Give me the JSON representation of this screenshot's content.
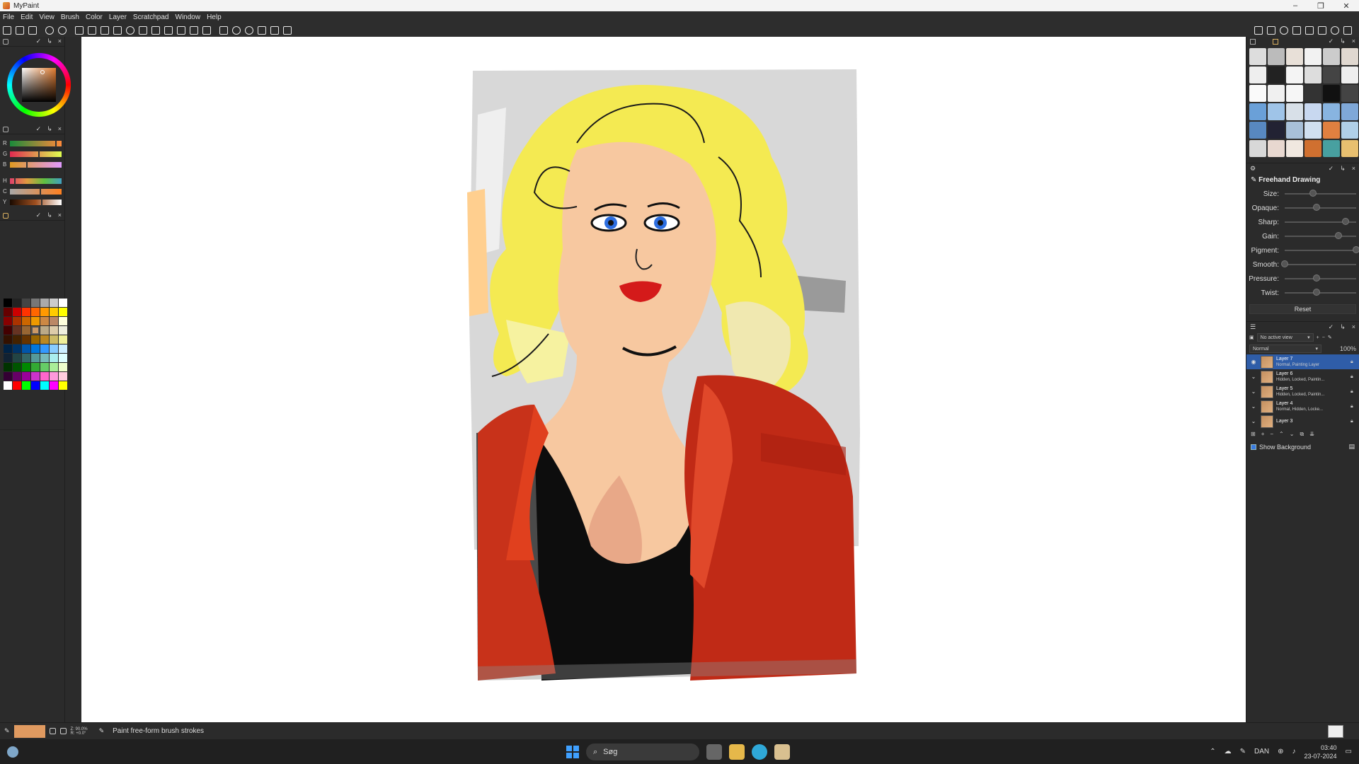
{
  "window": {
    "title": "MyPaint",
    "controls": [
      "–",
      "❐",
      "✕"
    ]
  },
  "menu": [
    "File",
    "Edit",
    "View",
    "Brush",
    "Color",
    "Layer",
    "Scratchpad",
    "Window",
    "Help"
  ],
  "color_sliders": {
    "labels": [
      "R",
      "G",
      "B",
      "H",
      "C",
      "Y"
    ]
  },
  "brush_settings": {
    "brush_name": "Freehand Drawing",
    "settings": [
      {
        "label": "Size:",
        "value": 0.4
      },
      {
        "label": "Opaque:",
        "value": 0.45
      },
      {
        "label": "Sharp:",
        "value": 0.85
      },
      {
        "label": "Gain:",
        "value": 0.75
      },
      {
        "label": "Pigment:",
        "value": 1.0
      },
      {
        "label": "Smooth:",
        "value": 0.0
      },
      {
        "label": "Pressure:",
        "value": 0.45
      },
      {
        "label": "Twist:",
        "value": 0.45
      }
    ],
    "reset_label": "Reset"
  },
  "layers": {
    "view_label": "No active view",
    "mode": "Normal",
    "opacity": "100%",
    "items": [
      {
        "name": "Layer 7",
        "desc": "Normal, Painting Layer",
        "active": true
      },
      {
        "name": "Layer 6",
        "desc": "Hidden, Locked, Paintin...",
        "active": false
      },
      {
        "name": "Layer 5",
        "desc": "Hidden, Locked, Paintin...",
        "active": false
      },
      {
        "name": "Layer 4",
        "desc": "Normal, Hidden, Locke...",
        "active": false
      },
      {
        "name": "Layer 3",
        "desc": "",
        "active": false
      }
    ],
    "show_background": "Show Background"
  },
  "statusbar": {
    "zoom_readout": "Z: 90.0%",
    "rotation_readout": "R: +0.0°",
    "hint": "Paint free-form brush strokes",
    "current_color": "#e09a60"
  },
  "taskbar": {
    "search_placeholder": "Søg",
    "language": "DAN",
    "time": "03:40",
    "date": "23-07-2024"
  },
  "colors": {
    "accent": "#2f5da8",
    "canvas": "#ffffff"
  }
}
